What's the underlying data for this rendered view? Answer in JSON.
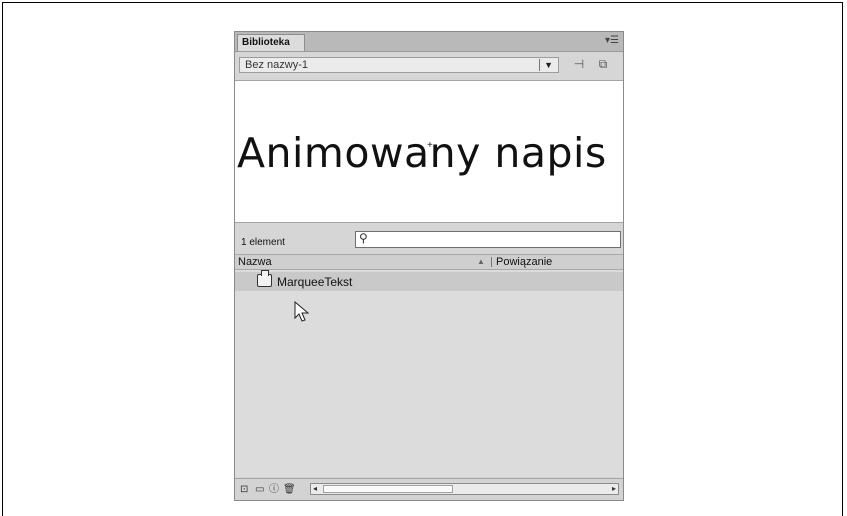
{
  "panel": {
    "tab_label": "Biblioteka",
    "menu_icon": "panel-menu-icon",
    "library_selector": {
      "value": "Bez nazwy-1",
      "icon": "chevron-down-icon"
    },
    "toolbar_icons": [
      "pin-icon",
      "new-library-panel-icon"
    ]
  },
  "preview": {
    "text": "Animowany napis",
    "marker": "crosshair-icon"
  },
  "library": {
    "count_label": "1 element",
    "search": {
      "value": "",
      "placeholder": "",
      "icon": "search-icon"
    },
    "columns": {
      "name": "Nazwa",
      "linkage": "Powiązanie",
      "sort_icon": "sort-up-icon"
    },
    "items": [
      {
        "name": "MarqueeTekst",
        "icon": "movie-clip-icon"
      }
    ]
  },
  "bottom_bar": {
    "buttons": [
      "new-symbol-icon",
      "new-folder-icon",
      "properties-icon",
      "delete-icon"
    ]
  }
}
